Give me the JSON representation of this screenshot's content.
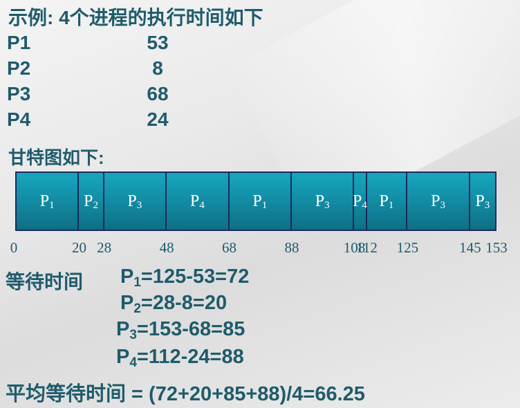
{
  "title": "示例: 4个进程的执行时间如下",
  "processes": [
    {
      "name": "P1",
      "time": "53"
    },
    {
      "name": "P2",
      "time": "8"
    },
    {
      "name": "P3",
      "time": "68"
    },
    {
      "name": "P4",
      "time": "24"
    }
  ],
  "gantt_label": "甘特图如下:",
  "gantt": {
    "segments": [
      {
        "p": "P",
        "sub": "1",
        "start": 0,
        "end": 20
      },
      {
        "p": "P",
        "sub": "2",
        "start": 20,
        "end": 28
      },
      {
        "p": "P",
        "sub": "3",
        "start": 28,
        "end": 48
      },
      {
        "p": "P",
        "sub": "4",
        "start": 48,
        "end": 68
      },
      {
        "p": "P",
        "sub": "1",
        "start": 68,
        "end": 88
      },
      {
        "p": "P",
        "sub": "3",
        "start": 88,
        "end": 108
      },
      {
        "p": "P",
        "sub": "4",
        "start": 108,
        "end": 112
      },
      {
        "p": "P",
        "sub": "1",
        "start": 112,
        "end": 125
      },
      {
        "p": "P",
        "sub": "3",
        "start": 125,
        "end": 145
      },
      {
        "p": "P",
        "sub": "3",
        "start": 145,
        "end": 153
      }
    ],
    "ticks": [
      "0",
      "20",
      "28",
      "48",
      "68",
      "88",
      "108",
      "112",
      "125",
      "145",
      "153"
    ],
    "colors": {
      "fill": "#138ea7",
      "border": "#1b2a5a"
    }
  },
  "wait_label": "等待时间",
  "formulas": [
    {
      "p": "P",
      "sub": "1",
      "expr": "=125-53=72"
    },
    {
      "p": "P",
      "sub": "2",
      "expr": "=28-8=20"
    },
    {
      "p": "P",
      "sub": "3",
      "expr": "=153-68=85"
    },
    {
      "p": "P",
      "sub": "4",
      "expr": "=112-24=88"
    }
  ],
  "average": "平均等待时间 = (72+20+85+88)/4=66.25"
}
